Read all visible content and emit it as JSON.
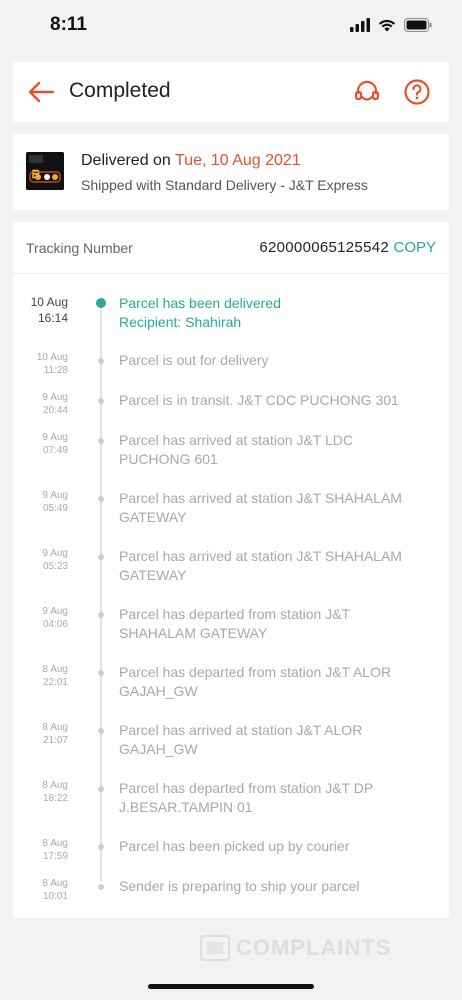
{
  "status_bar": {
    "time": "8:11"
  },
  "header": {
    "title": "Completed"
  },
  "delivery": {
    "prefix": "Delivered on ",
    "date": "Tue, 10 Aug 2021",
    "shipped": "Shipped with Standard Delivery  - J&T Express"
  },
  "tracking": {
    "label": "Tracking Number",
    "number": "620000065125542",
    "copy_label": "COPY"
  },
  "events": [
    {
      "date": "10 Aug",
      "time": "16:14",
      "text": "Parcel has been delivered",
      "text2": "Recipient: Shahirah",
      "active": true
    },
    {
      "date": "10 Aug",
      "time": "11:28",
      "text": "Parcel is out for delivery",
      "text2": ""
    },
    {
      "date": "9 Aug",
      "time": "20:44",
      "text": "Parcel is in transit. J&T CDC PUCHONG 301",
      "text2": ""
    },
    {
      "date": "9 Aug",
      "time": "07:49",
      "text": "Parcel has arrived at station J&T LDC",
      "text2": "PUCHONG 601"
    },
    {
      "date": "9 Aug",
      "time": "05:49",
      "text": "Parcel has arrived at station J&T SHAHALAM",
      "text2": "GATEWAY"
    },
    {
      "date": "9 Aug",
      "time": "05:23",
      "text": "Parcel has arrived at station J&T SHAHALAM",
      "text2": "GATEWAY"
    },
    {
      "date": "9 Aug",
      "time": "04:06",
      "text": "Parcel has departed from station J&T",
      "text2": "SHAHALAM GATEWAY"
    },
    {
      "date": "8 Aug",
      "time": "22:01",
      "text": "Parcel has departed from station J&T ALOR",
      "text2": "GAJAH_GW"
    },
    {
      "date": "8 Aug",
      "time": "21:07",
      "text": "Parcel has arrived at station J&T ALOR",
      "text2": "GAJAH_GW"
    },
    {
      "date": "8 Aug",
      "time": "18:22",
      "text": "Parcel has departed from station J&T DP",
      "text2": "J.BESAR.TAMPIN 01"
    },
    {
      "date": "8 Aug",
      "time": "17:59",
      "text": "Parcel has been picked up by courier",
      "text2": ""
    },
    {
      "date": "8 Aug",
      "time": "10:01",
      "text": "Sender is preparing to ship your parcel",
      "text2": ""
    }
  ],
  "watermark": {
    "text": "COMPLAINTS"
  },
  "colors": {
    "accent_orange": "#e8502a",
    "accent_teal": "#26aa99"
  },
  "icons": [
    "back-arrow-icon",
    "headset-icon",
    "help-circle-icon",
    "signal-icon",
    "wifi-icon",
    "battery-icon"
  ]
}
